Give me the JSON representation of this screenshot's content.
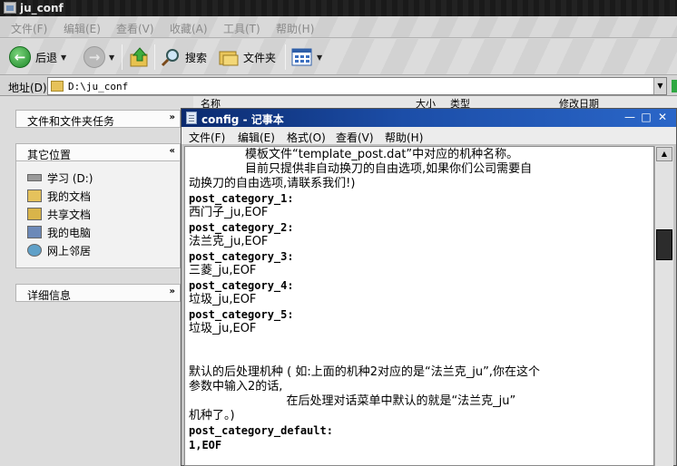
{
  "explorer": {
    "title": "ju_conf",
    "menu": [
      "文件(F)",
      "编辑(E)",
      "查看(V)",
      "收藏(A)",
      "工具(T)",
      "帮助(H)"
    ],
    "toolbar": {
      "back_label": "后退",
      "search_label": "搜索",
      "folders_label": "文件夹"
    },
    "address": {
      "label": "地址(D)",
      "value": "D:\\ju_conf"
    },
    "columns": {
      "name": "名称",
      "size": "大小",
      "type": "类型",
      "modified": "修改日期"
    }
  },
  "taskpane": {
    "file_tasks": "文件和文件夹任务",
    "other_places": {
      "title": "其它位置",
      "items": [
        {
          "label": "学习 (D:)",
          "icon": "drive-icon"
        },
        {
          "label": "我的文档",
          "icon": "my-documents-icon"
        },
        {
          "label": "共享文档",
          "icon": "shared-documents-icon"
        },
        {
          "label": "我的电脑",
          "icon": "my-computer-icon"
        },
        {
          "label": "网上邻居",
          "icon": "network-places-icon"
        }
      ]
    },
    "details": "详细信息"
  },
  "notepad": {
    "title": "config - 记事本",
    "menu": [
      "文件(F)",
      "编辑(E)",
      "格式(O)",
      "查看(V)",
      "帮助(H)"
    ],
    "lines": [
      "               模板文件“template_post.dat”中对应的机种名称。",
      "               目前只提供非自动换刀的自由选项,如果你们公司需要自",
      "动换刀的自由选项,请联系我们!)",
      "post_category_1:",
      "西门子_ju,EOF",
      "post_category_2:",
      "法兰克_ju,EOF",
      "post_category_3:",
      "三菱_ju,EOF",
      "post_category_4:",
      "垃圾_ju,EOF",
      "post_category_5:",
      "垃圾_ju,EOF",
      "",
      "",
      "默认的后处理机种 ( 如:上面的机种2对应的是“法兰克_ju”,你在这个",
      "参数中输入2的话,",
      "                          在后处理对话菜单中默认的就是“法兰克_ju”",
      "机种了。)",
      "post_category_default:",
      "1,EOF"
    ]
  }
}
